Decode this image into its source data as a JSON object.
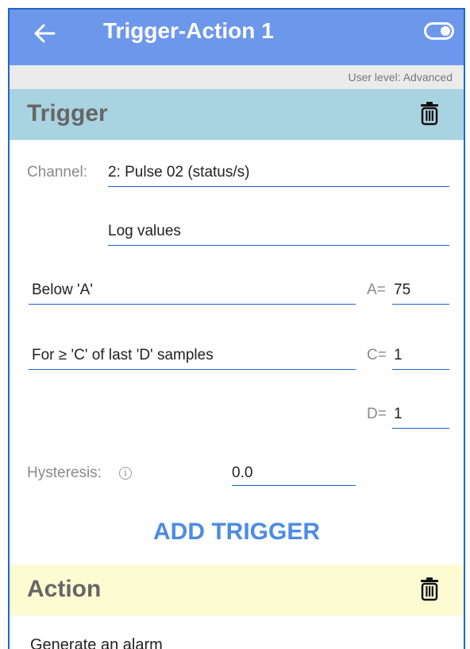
{
  "appbar": {
    "title": "Trigger-Action 1",
    "back_icon": "arrow-left-icon",
    "toggle_state": "on",
    "background": "#6d97eb"
  },
  "user_level": "User level: Advanced",
  "trigger": {
    "title": "Trigger",
    "header_color": "#aad3e1",
    "channel_label": "Channel:",
    "channel_value": "2: Pulse 02 (status/s)",
    "log_values": "Log values",
    "condition": "Below 'A'",
    "a_label": "A=",
    "a_value": "75",
    "sample_rule": "For ≥ 'C' of last 'D' samples",
    "c_label": "C=",
    "c_value": "1",
    "d_label": "D=",
    "d_value": "1",
    "hysteresis_label": "Hysteresis:",
    "hysteresis_info": "i",
    "hysteresis_value": "0.0",
    "add_button": "ADD TRIGGER"
  },
  "action": {
    "title": "Action",
    "header_color": "#fdfbd2",
    "first_item": "Generate an alarm"
  }
}
